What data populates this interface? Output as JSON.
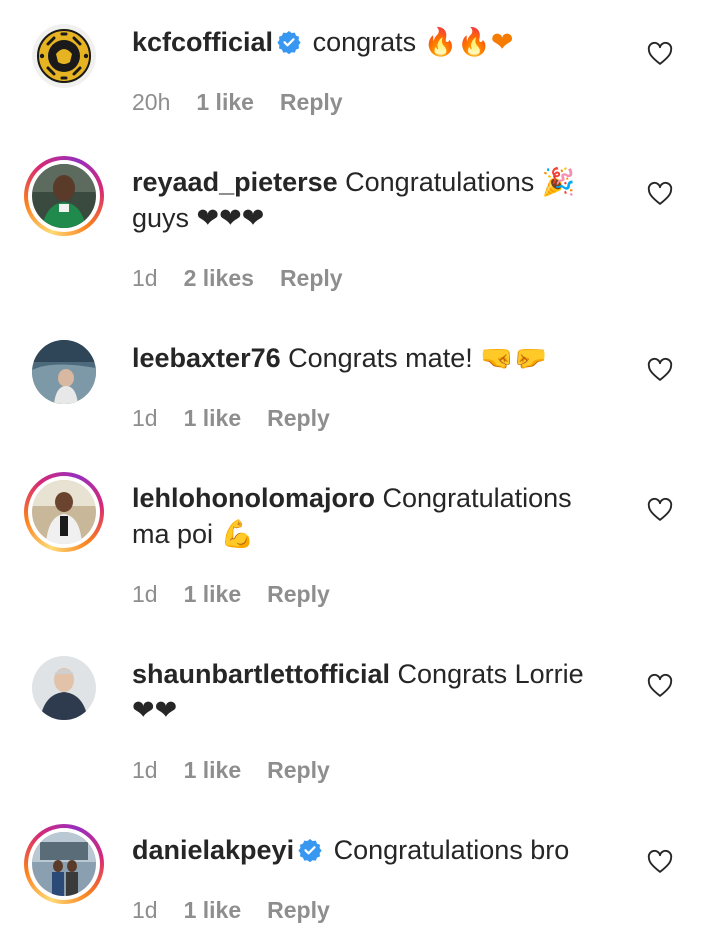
{
  "comments": [
    {
      "username": "kcfcofficial",
      "verified": true,
      "text": "congrats",
      "emojis": "🔥🔥❤",
      "time": "20h",
      "likes": "1 like",
      "reply": "Reply"
    },
    {
      "username": "reyaad_pieterse",
      "verified": false,
      "text": "Congratulations 🎉 guys ❤❤❤",
      "time": "1d",
      "likes": "2 likes",
      "reply": "Reply"
    },
    {
      "username": "leebaxter76",
      "verified": false,
      "text": "Congrats mate! 🤜🤛",
      "time": "1d",
      "likes": "1 like",
      "reply": "Reply"
    },
    {
      "username": "lehlohonolomajoro",
      "verified": false,
      "text": "Congratulations ma poi 💪",
      "time": "1d",
      "likes": "1 like",
      "reply": "Reply"
    },
    {
      "username": "shaunbartlettofficial",
      "verified": false,
      "text": "Congrats Lorrie ❤❤",
      "time": "1d",
      "likes": "1 like",
      "reply": "Reply"
    },
    {
      "username": "danielakpeyi",
      "verified": true,
      "text": "Congratulations bro",
      "time": "1d",
      "likes": "1 like",
      "reply": "Reply"
    }
  ],
  "colors": {
    "verified_badge": "#3897f0",
    "meta_text": "#8e8e8e",
    "primary_text": "#262626",
    "heart_emoji": "#e0182d"
  },
  "icons": {
    "like": "heart-outline-icon",
    "verified": "verified-badge-icon"
  }
}
